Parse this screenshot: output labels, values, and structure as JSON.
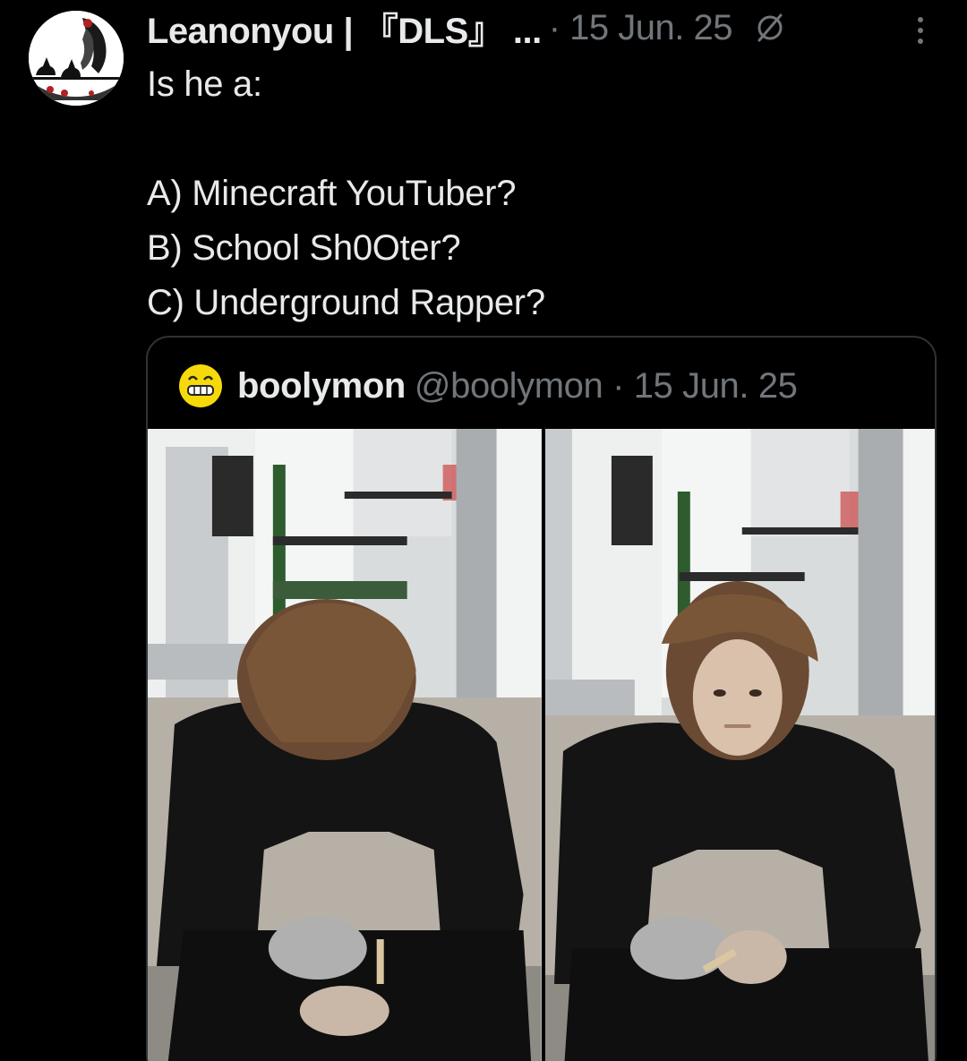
{
  "tweet": {
    "display_name": "Leanonyou | 『DLS』 ...",
    "meta": "· 15 Jun. 25",
    "lines": [
      "Is he a:",
      "",
      "A) Minecraft YouTuber?",
      "B) School Sh0Oter?",
      "C) Underground Rapper?"
    ]
  },
  "quote": {
    "display_name": "boolymon",
    "meta": "@boolymon · 15 Jun. 25"
  },
  "icons": {
    "verified": "null-set-icon",
    "more": "more-vertical-icon",
    "quote_avatar": "yellow-face-icon"
  },
  "colors": {
    "background": "#000000",
    "text_primary": "#e7e9ea",
    "text_secondary": "#71767b",
    "border": "#2f3336",
    "quote_avatar": "#f5d90a"
  }
}
